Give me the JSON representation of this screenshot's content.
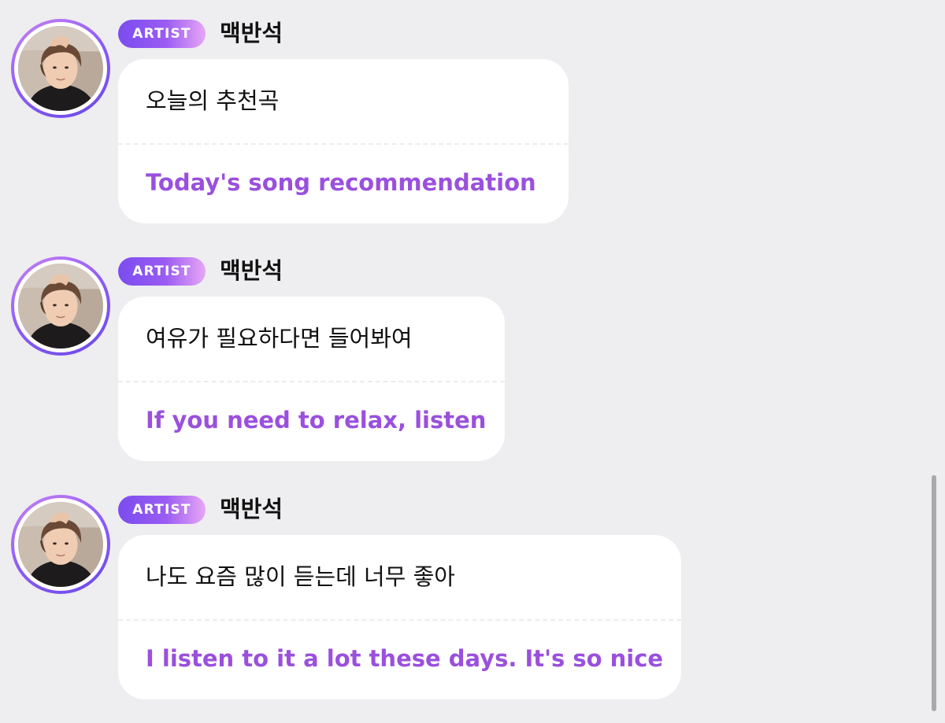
{
  "badge_label": "ARTIST",
  "colors": {
    "background": "#eeedef",
    "bubble": "#ffffff",
    "translation_text": "#9a50dd",
    "badge_gradient_start": "#7a4cf0",
    "badge_gradient_end": "#e7a6f5",
    "avatar_ring": "#8b5cf6"
  },
  "messages": [
    {
      "sender": "맥반석",
      "badge": "ARTIST",
      "avatar_icon": "artist-avatar",
      "original": "오늘의 추천곡",
      "translation": "Today's song recommendation"
    },
    {
      "sender": "맥반석",
      "badge": "ARTIST",
      "avatar_icon": "artist-avatar",
      "original": "여유가 필요하다면 들어봐여",
      "translation": "If you need to relax, listen"
    },
    {
      "sender": "맥반석",
      "badge": "ARTIST",
      "avatar_icon": "artist-avatar",
      "original": "나도 요즘 많이 듣는데 너무 좋아",
      "translation": "I listen to it a lot these days. It's so nice"
    }
  ]
}
